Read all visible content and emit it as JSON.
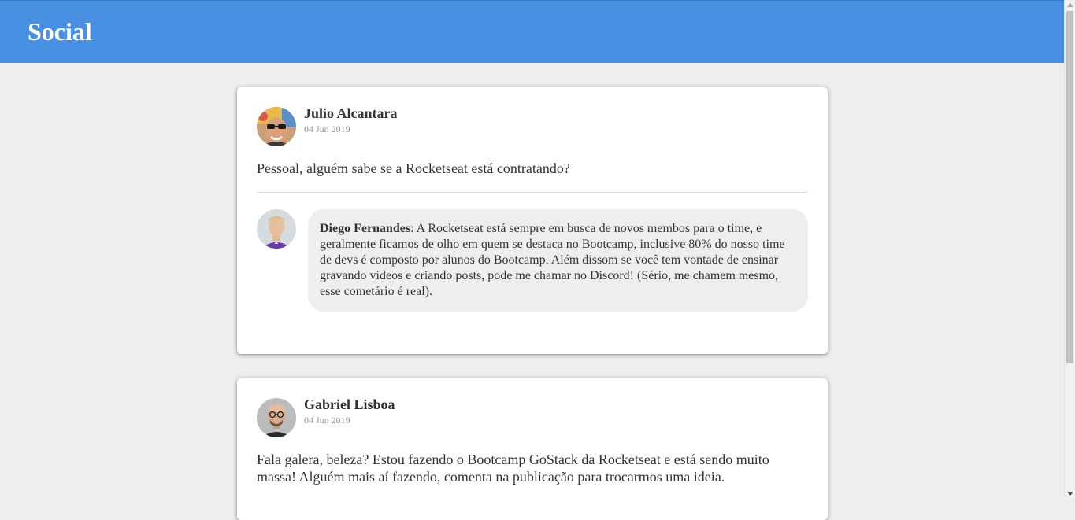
{
  "header": {
    "title": "Social"
  },
  "posts": [
    {
      "author": "Julio Alcantara",
      "date": "04 Jun 2019",
      "content": "Pessoal, alguém sabe se a Rocketseat está contratando?",
      "comments": [
        {
          "author": "Diego Fernandes",
          "separator": ":",
          "content": " A Rocketseat está sempre em busca de novos membos para o time, e geralmente ficamos de olho em quem se destaca no Bootcamp, inclusive 80% do nosso time de devs é composto por alunos do Bootcamp. Além dissom se você tem vontade de ensinar gravando vídeos e criando posts, pode me chamar no Discord! (Sério, me chamem mesmo, esse cometário é real)."
        }
      ]
    },
    {
      "author": "Gabriel Lisboa",
      "date": "04 Jun 2019",
      "content": "Fala galera, beleza? Estou fazendo o Bootcamp GoStack da Rocketseat e está sendo muito massa! Alguém mais aí fazendo, comenta na publicação para trocarmos uma ideia."
    }
  ],
  "colors": {
    "header_bg": "#4a90e2",
    "page_bg": "#eeeeee",
    "bubble_bg": "#eeeeee"
  }
}
